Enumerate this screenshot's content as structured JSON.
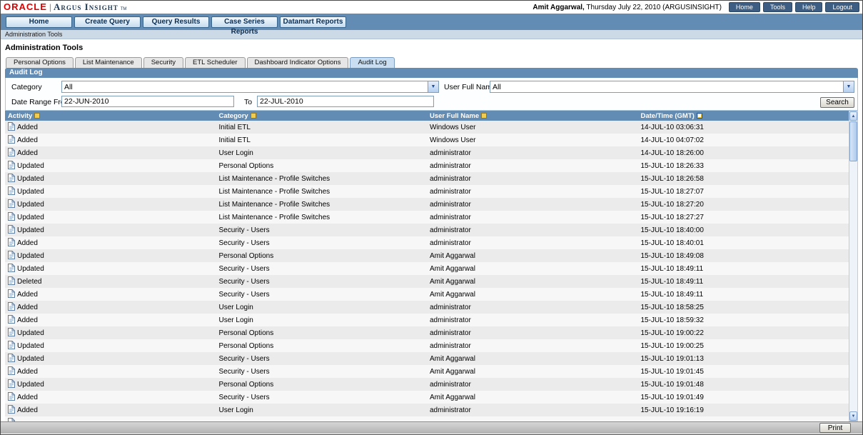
{
  "header": {
    "logo": "ORACLE",
    "product": "Argus Insight",
    "tm": "TM",
    "user_bold": "Amit Aggarwal,",
    "user_rest": " Thursday July 22, 2010 (ARGUSINSIGHT)",
    "buttons": [
      "Home",
      "Tools",
      "Help",
      "Logout"
    ]
  },
  "nav": {
    "tabs": [
      "Home",
      "Create Query",
      "Query Results",
      "Case Series Reports",
      "Datamart Reports"
    ]
  },
  "breadcrumb": "Administration Tools",
  "page_title": "Administration Tools",
  "admin_tabs": [
    {
      "label": "Personal Options"
    },
    {
      "label": "List Maintenance"
    },
    {
      "label": "Security"
    },
    {
      "label": "ETL Scheduler"
    },
    {
      "label": "Dashboard Indicator Options"
    },
    {
      "label": "Audit Log",
      "active": true
    }
  ],
  "audit_panel": {
    "title": "Audit Log",
    "filters": {
      "category_label": "Category",
      "category_value": "All",
      "user_label": "User Full Name",
      "user_value": "All",
      "date_from_label": "Date Range From",
      "date_from_value": "22-JUN-2010",
      "to_label": "To",
      "to_value": "22-JUL-2010",
      "search_label": "Search"
    }
  },
  "table": {
    "columns": [
      "Activity",
      "Category",
      "User Full Name",
      "Date/Time (GMT)"
    ],
    "rows": [
      {
        "activity": "Added",
        "category": "Initial ETL",
        "user": "Windows User",
        "datetime": "14-JUL-10 03:06:31"
      },
      {
        "activity": "Added",
        "category": "Initial ETL",
        "user": "Windows User",
        "datetime": "14-JUL-10 04:07:02"
      },
      {
        "activity": "Added",
        "category": "User Login",
        "user": "administrator",
        "datetime": "14-JUL-10 18:26:00"
      },
      {
        "activity": "Updated",
        "category": "Personal Options",
        "user": "administrator",
        "datetime": "15-JUL-10 18:26:33"
      },
      {
        "activity": "Updated",
        "category": "List Maintenance - Profile Switches",
        "user": "administrator",
        "datetime": "15-JUL-10 18:26:58"
      },
      {
        "activity": "Updated",
        "category": "List Maintenance - Profile Switches",
        "user": "administrator",
        "datetime": "15-JUL-10 18:27:07"
      },
      {
        "activity": "Updated",
        "category": "List Maintenance - Profile Switches",
        "user": "administrator",
        "datetime": "15-JUL-10 18:27:20"
      },
      {
        "activity": "Updated",
        "category": "List Maintenance - Profile Switches",
        "user": "administrator",
        "datetime": "15-JUL-10 18:27:27"
      },
      {
        "activity": "Updated",
        "category": "Security - Users",
        "user": "administrator",
        "datetime": "15-JUL-10 18:40:00"
      },
      {
        "activity": "Added",
        "category": "Security - Users",
        "user": "administrator",
        "datetime": "15-JUL-10 18:40:01"
      },
      {
        "activity": "Updated",
        "category": "Personal Options",
        "user": "Amit Aggarwal",
        "datetime": "15-JUL-10 18:49:08"
      },
      {
        "activity": "Updated",
        "category": "Security - Users",
        "user": "Amit Aggarwal",
        "datetime": "15-JUL-10 18:49:11"
      },
      {
        "activity": "Deleted",
        "category": "Security - Users",
        "user": "Amit Aggarwal",
        "datetime": "15-JUL-10 18:49:11"
      },
      {
        "activity": "Added",
        "category": "Security - Users",
        "user": "Amit Aggarwal",
        "datetime": "15-JUL-10 18:49:11"
      },
      {
        "activity": "Added",
        "category": "User Login",
        "user": "administrator",
        "datetime": "15-JUL-10 18:58:25"
      },
      {
        "activity": "Added",
        "category": "User Login",
        "user": "administrator",
        "datetime": "15-JUL-10 18:59:32"
      },
      {
        "activity": "Updated",
        "category": "Personal Options",
        "user": "administrator",
        "datetime": "15-JUL-10 19:00:22"
      },
      {
        "activity": "Updated",
        "category": "Personal Options",
        "user": "administrator",
        "datetime": "15-JUL-10 19:00:25"
      },
      {
        "activity": "Updated",
        "category": "Security - Users",
        "user": "Amit Aggarwal",
        "datetime": "15-JUL-10 19:01:13"
      },
      {
        "activity": "Added",
        "category": "Security - Users",
        "user": "Amit Aggarwal",
        "datetime": "15-JUL-10 19:01:45"
      },
      {
        "activity": "Updated",
        "category": "Personal Options",
        "user": "administrator",
        "datetime": "15-JUL-10 19:01:48"
      },
      {
        "activity": "Added",
        "category": "Security - Users",
        "user": "Amit Aggarwal",
        "datetime": "15-JUL-10 19:01:49"
      },
      {
        "activity": "Added",
        "category": "User Login",
        "user": "administrator",
        "datetime": "15-JUL-10 19:16:19"
      },
      {
        "activity": "",
        "category": "",
        "user": "",
        "datetime": ""
      }
    ]
  },
  "footer": {
    "print_label": "Print"
  },
  "colors": {
    "header_blue": "#628cb3",
    "oracle_red": "#e00000",
    "row_alt": "#ebebeb",
    "sort_icon_yellow": "#f0cc50"
  }
}
